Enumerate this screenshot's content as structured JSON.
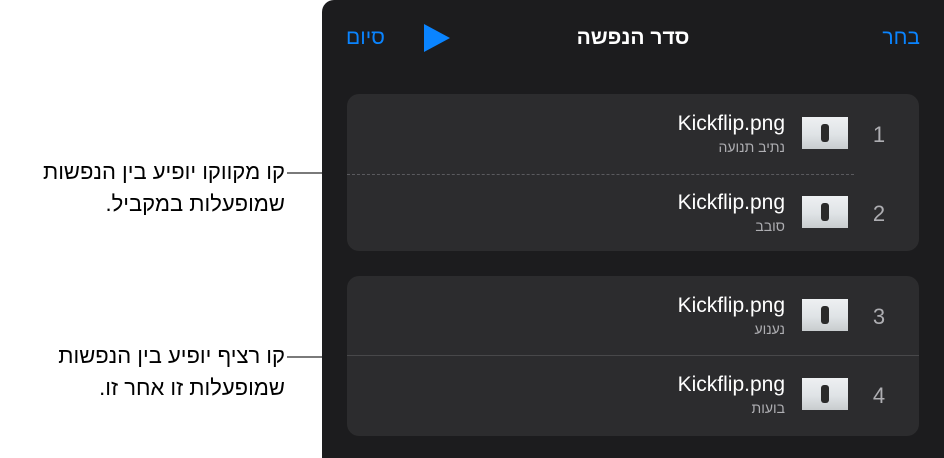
{
  "callouts": [
    {
      "line1": "קו מקווקו יופיע בין הנפשות",
      "line2": "שמופעלות במקביל."
    },
    {
      "line1": "קו רציף יופיע בין הנפשות",
      "line2": "שמופעלות זו אחר זו."
    }
  ],
  "nav": {
    "title": "סדר הנפשה",
    "select_label": "בחר",
    "done_label": "סיום",
    "play_icon": "play-icon"
  },
  "groups": [
    {
      "separator": "dashed",
      "items": [
        {
          "number": "1",
          "filename": "Kickflip.png",
          "effect": "נתיב תנועה"
        },
        {
          "number": "2",
          "filename": "Kickflip.png",
          "effect": "סובב"
        }
      ]
    },
    {
      "separator": "solid",
      "items": [
        {
          "number": "3",
          "filename": "Kickflip.png",
          "effect": "נענוע"
        },
        {
          "number": "4",
          "filename": "Kickflip.png",
          "effect": "בועות"
        }
      ]
    }
  ],
  "colors": {
    "accent": "#0a84ff",
    "panel_background": "#1c1c1e",
    "group_background": "#2c2c2e"
  }
}
